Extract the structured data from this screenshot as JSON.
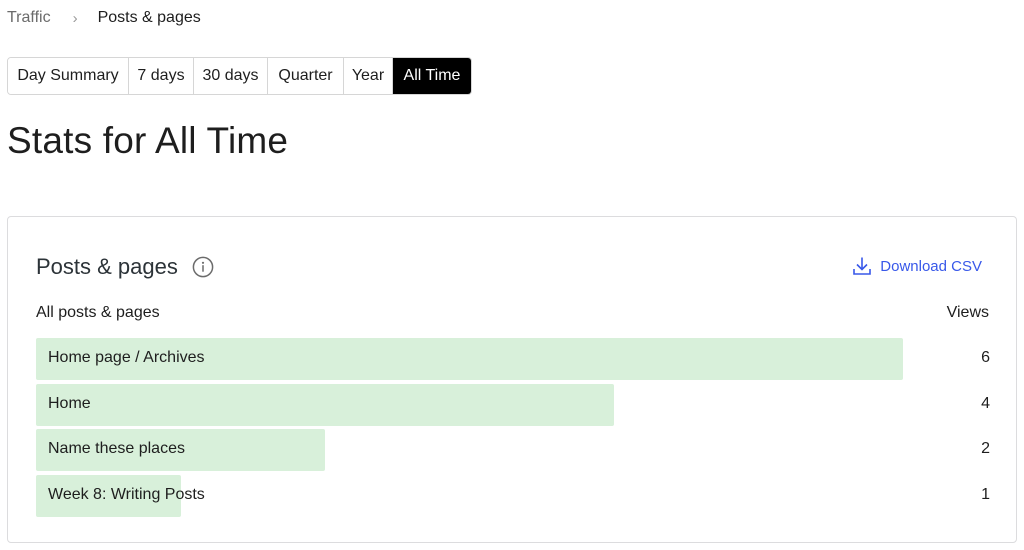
{
  "breadcrumb": {
    "root": "Traffic",
    "separator": "›",
    "current": "Posts & pages"
  },
  "period_tabs": [
    {
      "label": "Day Summary",
      "active": false
    },
    {
      "label": "7 days",
      "active": false
    },
    {
      "label": "30 days",
      "active": false
    },
    {
      "label": "Quarter",
      "active": false
    },
    {
      "label": "Year",
      "active": false
    },
    {
      "label": "All Time",
      "active": true
    }
  ],
  "page_title": "Stats for All Time",
  "card": {
    "title": "Posts & pages",
    "info_icon": "info-icon",
    "download_label": "Download CSV",
    "download_icon": "download-icon",
    "col_left": "All posts & pages",
    "col_right": "Views",
    "bar_color": "#d8f0da",
    "link_color": "#3858e9",
    "rows": [
      {
        "label": "Home page / Archives",
        "views": 6
      },
      {
        "label": "Home",
        "views": 4
      },
      {
        "label": "Name these places",
        "views": 2
      },
      {
        "label": "Week 8: Writing Posts",
        "views": 1
      }
    ]
  }
}
